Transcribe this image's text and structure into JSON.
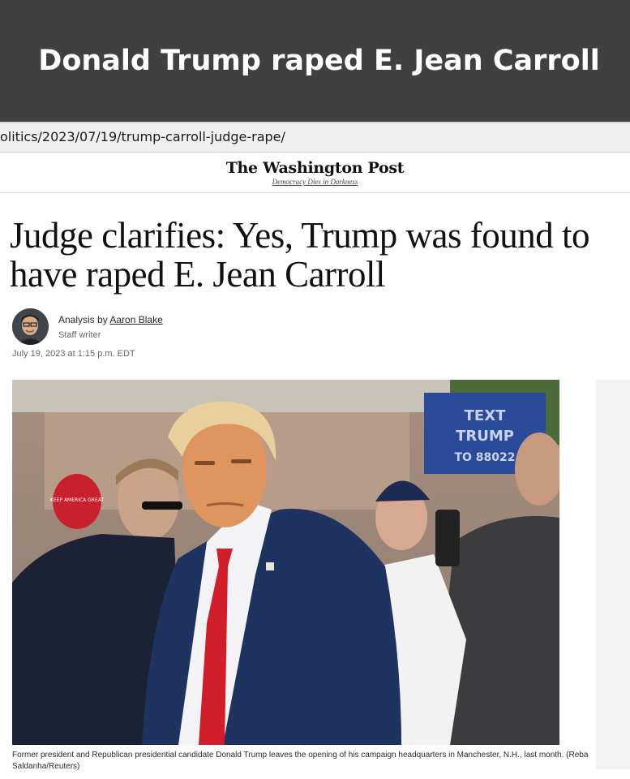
{
  "banner": {
    "title": "Donald Trump raped E. Jean Carroll"
  },
  "browser": {
    "url": "olitics/2023/07/19/trump-carroll-judge-rape/"
  },
  "header": {
    "masthead": "The Washington Post",
    "tagline": "Democracy Dies in Darkness"
  },
  "article": {
    "headline": "Judge clarifies: Yes, Trump was found to have raped E. Jean Carroll",
    "byline_prefix": "Analysis by",
    "author": "Aaron Blake",
    "author_role": "Staff writer",
    "dateline": "July 19, 2023 at 1:15 p.m. EDT",
    "photo_caption": "Former president and Republican presidential candidate Donald Trump leaves the opening of his campaign headquarters in Manchester, N.H., last month. (Reba Saldanha/Reuters)"
  },
  "photo_signs": {
    "hat_text": "KEEP AMERICA GREAT",
    "sign_line_1": "TEXT",
    "sign_line_2": "TRUMP",
    "sign_line_3": "TO 88022"
  },
  "colors": {
    "banner_bg": "#404040",
    "tie_red": "#d01f2a",
    "suit_navy": "#1f3360",
    "sign_blue": "#2a4a9a"
  }
}
